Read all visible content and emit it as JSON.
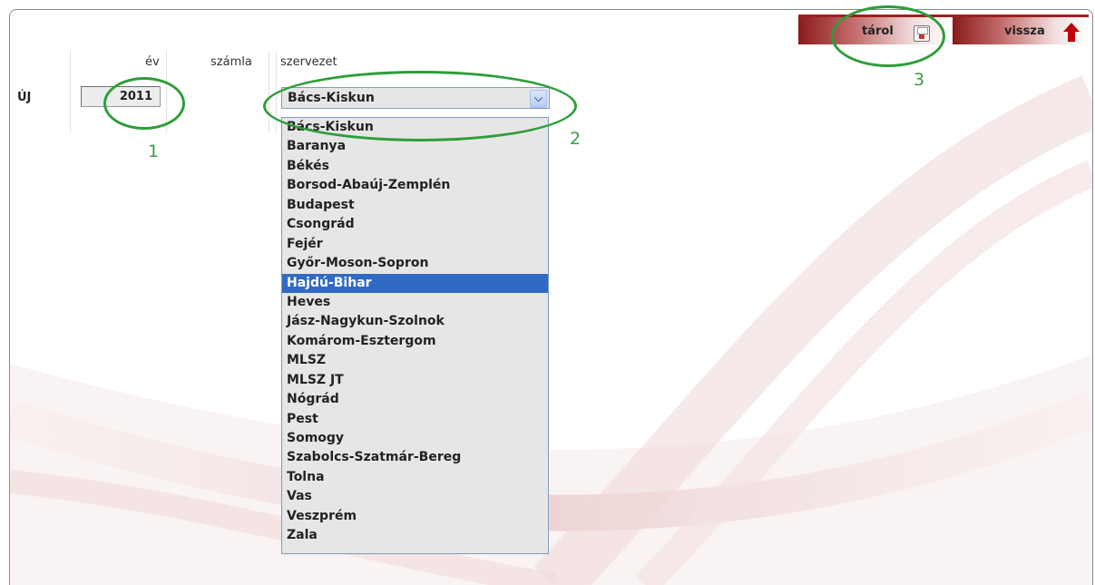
{
  "toolbar": {
    "save_label": "tárol",
    "back_label": "vissza"
  },
  "grid": {
    "col_year": "év",
    "col_account": "számla",
    "col_org": "szervezet",
    "row_label": "ÚJ",
    "year_value": "2011"
  },
  "org_select": {
    "selected": "Bács-Kiskun",
    "highlighted": "Hajdú-Bihar",
    "options": [
      "Bács-Kiskun",
      "Baranya",
      "Békés",
      "Borsod-Abaúj-Zemplén",
      "Budapest",
      "Csongrád",
      "Fejér",
      "Győr-Moson-Sopron",
      "Hajdú-Bihar",
      "Heves",
      "Jász-Nagykun-Szolnok",
      "Komárom-Esztergom",
      "MLSZ",
      "MLSZ JT",
      "Nógrád",
      "Pest",
      "Somogy",
      "Szabolcs-Szatmár-Bereg",
      "Tolna",
      "Vas",
      "Veszprém",
      "Zala"
    ]
  },
  "annotations": {
    "marker_1": "1",
    "marker_2": "2",
    "marker_3": "3"
  },
  "colors": {
    "accent_green": "#2e9e3a",
    "selection_blue": "#316ac5",
    "toolbar_red": "#8b1a1a"
  }
}
